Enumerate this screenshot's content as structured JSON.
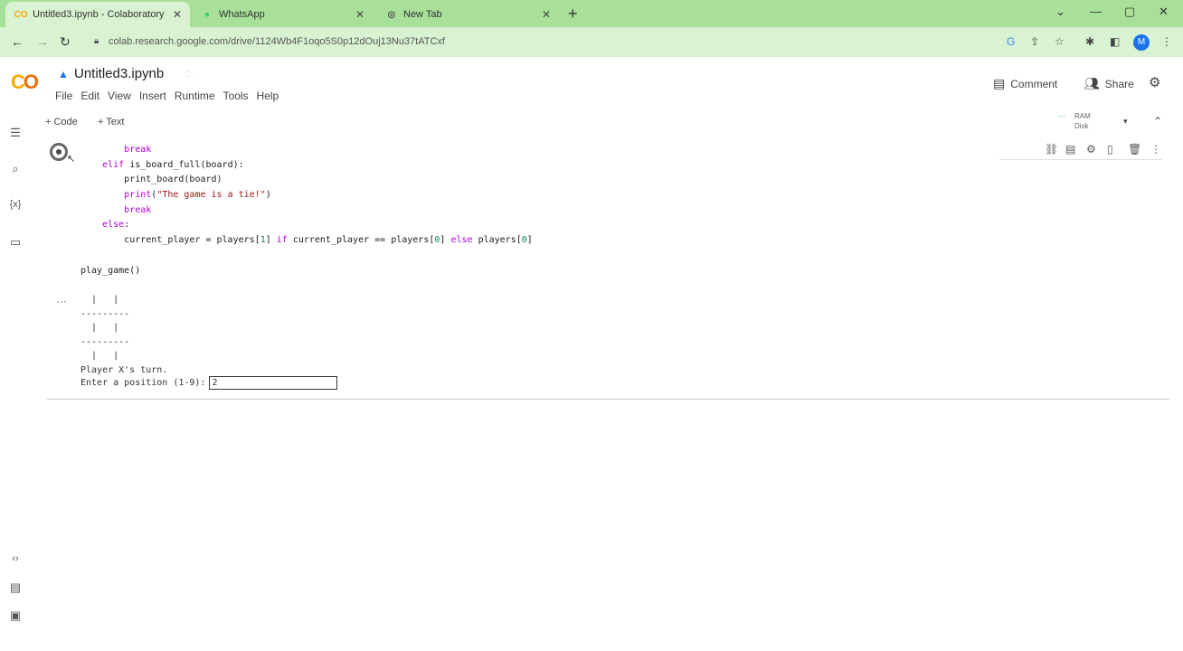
{
  "browser": {
    "tabs": [
      {
        "icon": "CO",
        "title": "Untitled3.ipynb - Colaboratory",
        "active": true
      },
      {
        "icon": "whatsapp-icon",
        "title": "WhatsApp",
        "active": false
      },
      {
        "icon": "chrome-icon",
        "title": "New Tab",
        "active": false
      }
    ],
    "url": "colab.research.google.com/drive/1124Wb4F1oqo5S0p12dOuj13Nu37tATCxf",
    "profile_initial": "M"
  },
  "colab": {
    "logo": "CO",
    "notebook_title": "Untitled3.ipynb",
    "menu": [
      "File",
      "Edit",
      "View",
      "Insert",
      "Runtime",
      "Tools",
      "Help"
    ],
    "comment_label": "Comment",
    "share_label": "Share",
    "add_code_label": "+ Code",
    "add_text_label": "+ Text",
    "ram_label": "RAM",
    "disk_label": "Disk"
  },
  "cell": {
    "code_lines": [
      {
        "indent": "        ",
        "tokens": [
          {
            "t": "break",
            "c": "kw"
          }
        ]
      },
      {
        "indent": "    ",
        "tokens": [
          {
            "t": "elif",
            "c": "kw"
          },
          {
            "t": " is_board_full(board):",
            "c": ""
          }
        ]
      },
      {
        "indent": "        ",
        "tokens": [
          {
            "t": "print_board(board)",
            "c": ""
          }
        ]
      },
      {
        "indent": "        ",
        "tokens": [
          {
            "t": "print",
            "c": "kw"
          },
          {
            "t": "(",
            "c": ""
          },
          {
            "t": "\"The game is a tie!\"",
            "c": "str"
          },
          {
            "t": ")",
            "c": ""
          }
        ]
      },
      {
        "indent": "        ",
        "tokens": [
          {
            "t": "break",
            "c": "kw"
          }
        ]
      },
      {
        "indent": "    ",
        "tokens": [
          {
            "t": "else",
            "c": "kw"
          },
          {
            "t": ":",
            "c": ""
          }
        ]
      },
      {
        "indent": "        ",
        "tokens": [
          {
            "t": "current_player = players[",
            "c": ""
          },
          {
            "t": "1",
            "c": "num"
          },
          {
            "t": "] ",
            "c": ""
          },
          {
            "t": "if",
            "c": "kw"
          },
          {
            "t": " current_player == players[",
            "c": ""
          },
          {
            "t": "0",
            "c": "num"
          },
          {
            "t": "] ",
            "c": ""
          },
          {
            "t": "else",
            "c": "kw"
          },
          {
            "t": " players[",
            "c": ""
          },
          {
            "t": "0",
            "c": "num"
          },
          {
            "t": "]",
            "c": ""
          }
        ]
      },
      {
        "indent": "",
        "tokens": [
          {
            "t": "",
            "c": ""
          }
        ]
      },
      {
        "indent": "",
        "tokens": [
          {
            "t": "play_game()",
            "c": ""
          }
        ]
      }
    ],
    "output_lines": [
      "  |   |",
      "---------",
      "  |   |",
      "---------",
      "  |   |",
      "Player X's turn."
    ],
    "input_prompt": "Enter a position (1-9):",
    "input_value": "2"
  }
}
